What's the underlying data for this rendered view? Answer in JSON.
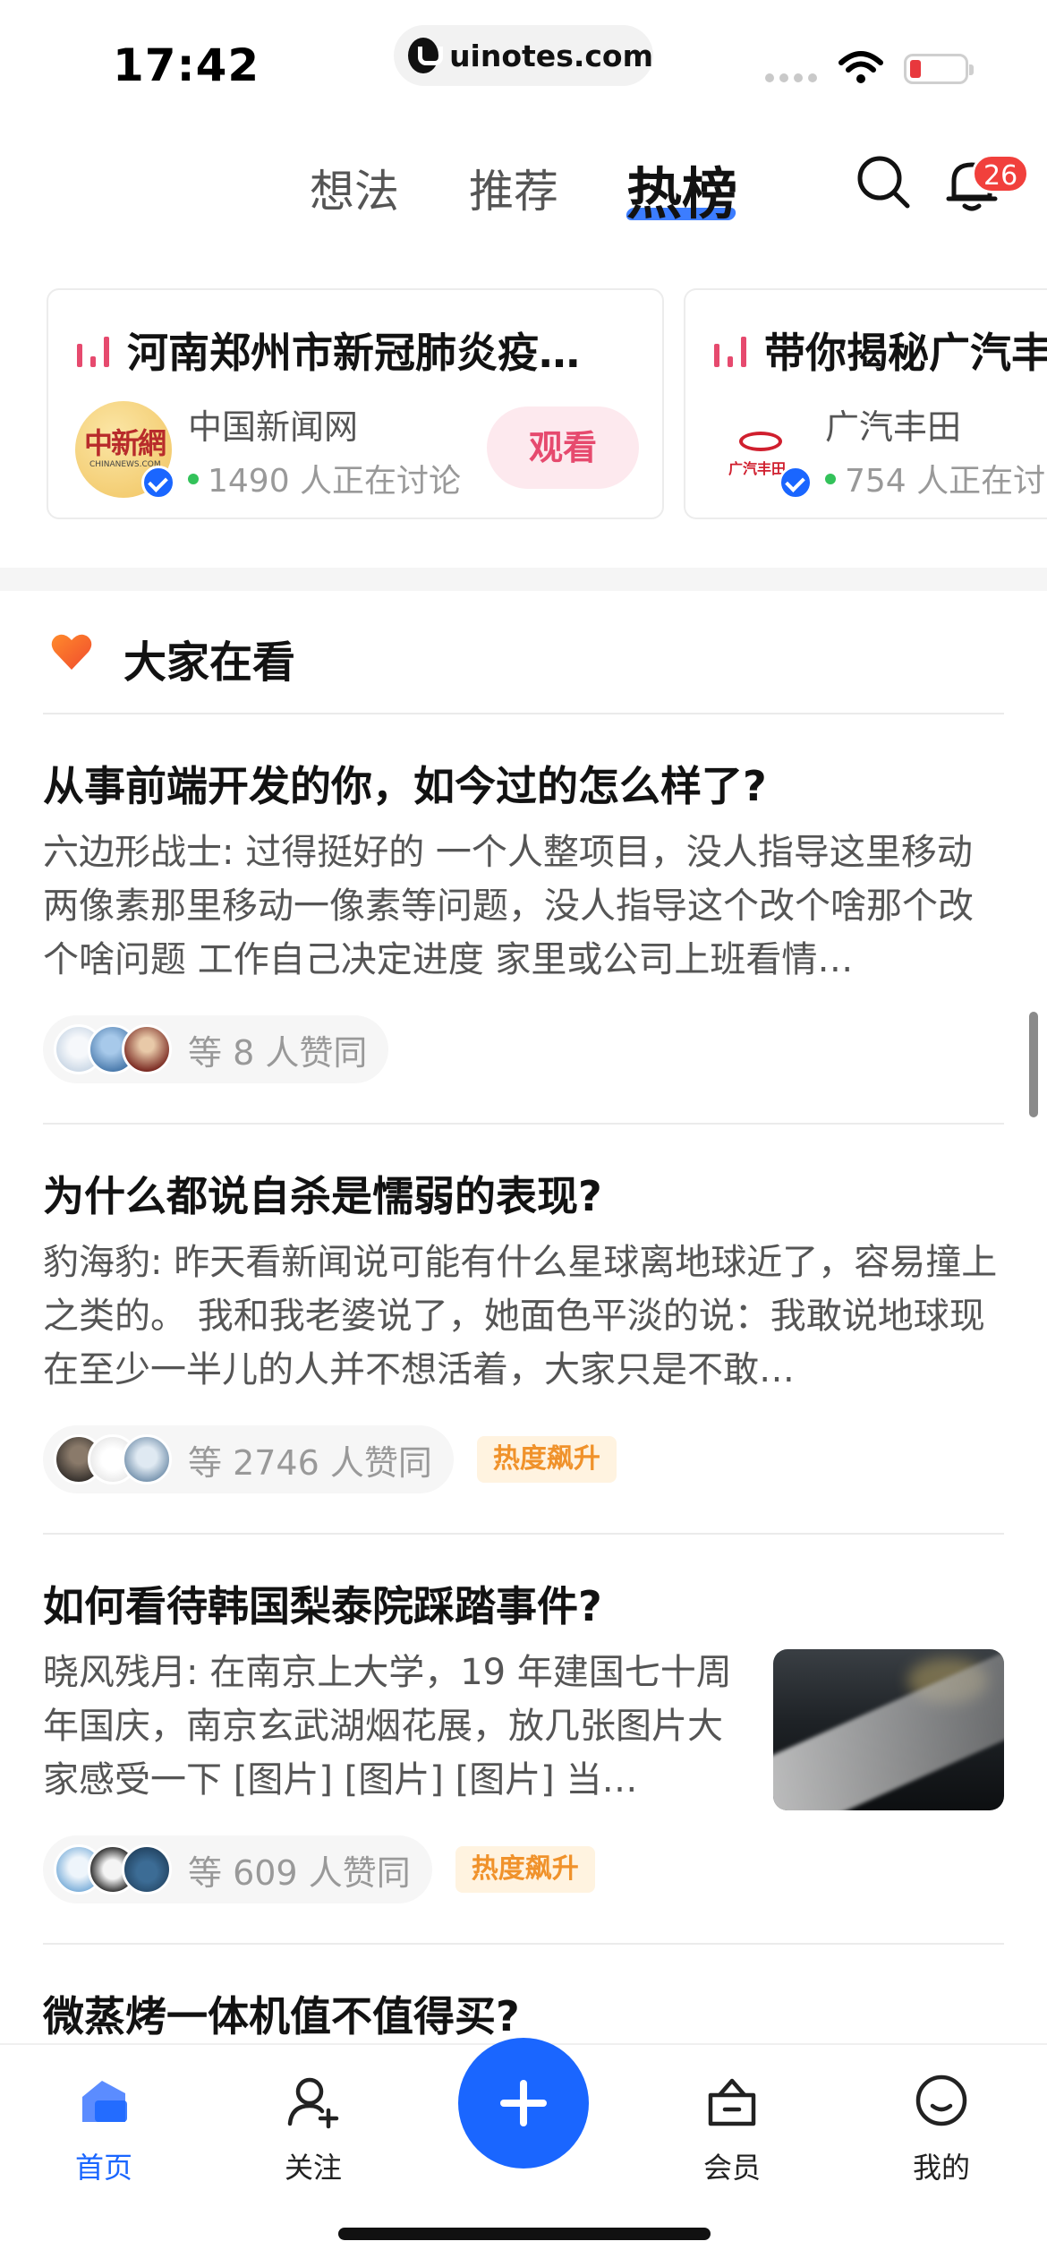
{
  "status_bar": {
    "time": "17:42",
    "url": "uinotes.com"
  },
  "top_nav": {
    "tabs": [
      {
        "label": "想法",
        "active": false
      },
      {
        "label": "推荐",
        "active": false
      },
      {
        "label": "热榜",
        "active": true
      }
    ],
    "notification_count": "26",
    "icons": [
      "search-icon",
      "bell-icon"
    ]
  },
  "hot_cards": [
    {
      "title": "河南郑州市新冠肺炎疫…",
      "source": "中国新闻网",
      "discussion": "1490 人正在讨论",
      "action_label": "观看",
      "avatar_text": "中新網",
      "avatar_subtext": "CHINANEWS.COM"
    },
    {
      "title": "带你揭秘广汽丰",
      "source": "广汽丰田",
      "discussion": "754 人正在讨",
      "avatar_text": "广汽丰田"
    }
  ],
  "section": {
    "title": "大家在看"
  },
  "questions": [
    {
      "title": "从事前端开发的你，如今过的怎么样了?",
      "excerpt": "六边形战士: 过得挺好的 一个人整项目，没人指导这里移动两像素那里移动一像素等问题，没人指导这个改个啥那个改个啥问题 工作自己决定进度 家里或公司上班看情…",
      "votes": "等 8 人赞同",
      "tag": ""
    },
    {
      "title": "为什么都说自杀是懦弱的表现?",
      "excerpt": "豹海豹: 昨天看新闻说可能有什么星球离地球近了，容易撞上之类的。 我和我老婆说了，她面色平淡的说：我敢说地球现在至少一半儿的人并不想活着，大家只是不敢…",
      "votes": "等 2746 人赞同",
      "tag": "热度飙升"
    },
    {
      "title": "如何看待韩国梨泰院踩踏事件?",
      "excerpt": "晓风残月: 在南京上大学，19 年建国七十周年国庆，南京玄武湖烟花展，放几张图片大家感受一下 [图片] [图片] [图片] 当…",
      "votes": "等 609 人赞同",
      "tag": "热度飙升"
    },
    {
      "title": "微蒸烤一体机值不值得买?"
    }
  ],
  "tab_bar": {
    "items": [
      {
        "label": "首页",
        "icon": "home-icon",
        "active": true
      },
      {
        "label": "关注",
        "icon": "follow-icon",
        "active": false
      },
      {
        "label": "",
        "icon": "plus-icon",
        "active": false
      },
      {
        "label": "会员",
        "icon": "member-icon",
        "active": false
      },
      {
        "label": "我的",
        "icon": "profile-icon",
        "active": false
      }
    ]
  },
  "colors": {
    "accent": "#1a66ff",
    "badge": "#f1403c",
    "hot_tag_bg": "#fff3e0",
    "hot_tag_text": "#f0922b",
    "watch_bg": "#fde9ee",
    "watch_text": "#e64a6e"
  }
}
